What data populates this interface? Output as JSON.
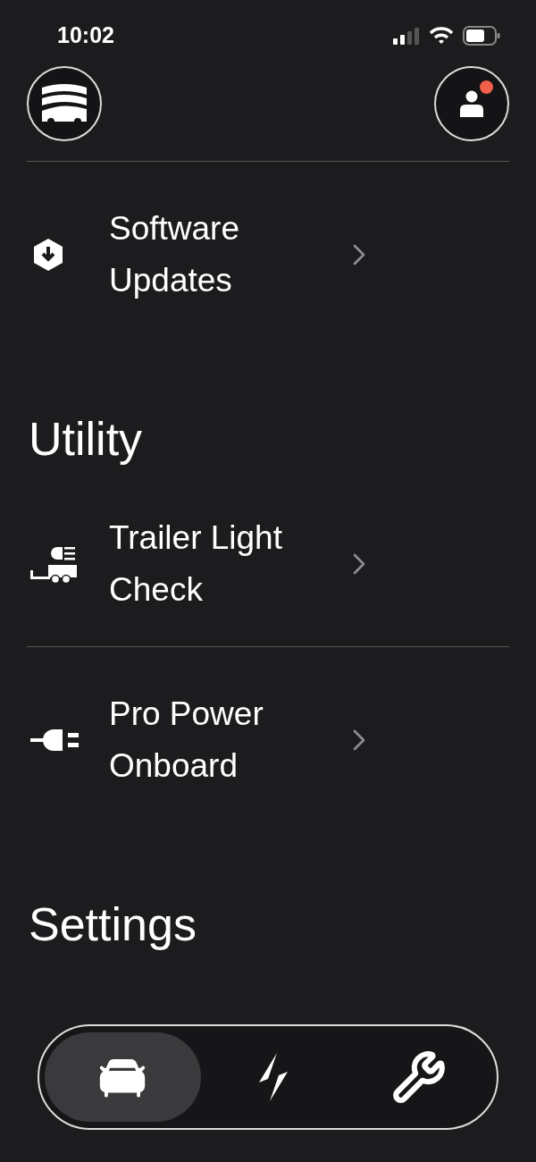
{
  "status_bar": {
    "time": "10:02"
  },
  "profile": {
    "badge": true
  },
  "top_items": [
    {
      "kind": "update",
      "label": "Software Updates"
    }
  ],
  "sections": [
    {
      "title": "Utility",
      "items": [
        {
          "kind": "trailer",
          "label": "Trailer Light Check"
        },
        {
          "kind": "power",
          "label": "Pro Power Onboard"
        }
      ]
    },
    {
      "title": "Settings"
    }
  ],
  "nav_tabs": [
    {
      "kind": "car",
      "selected": true
    },
    {
      "kind": "charge",
      "selected": false
    },
    {
      "kind": "service",
      "selected": false
    }
  ]
}
